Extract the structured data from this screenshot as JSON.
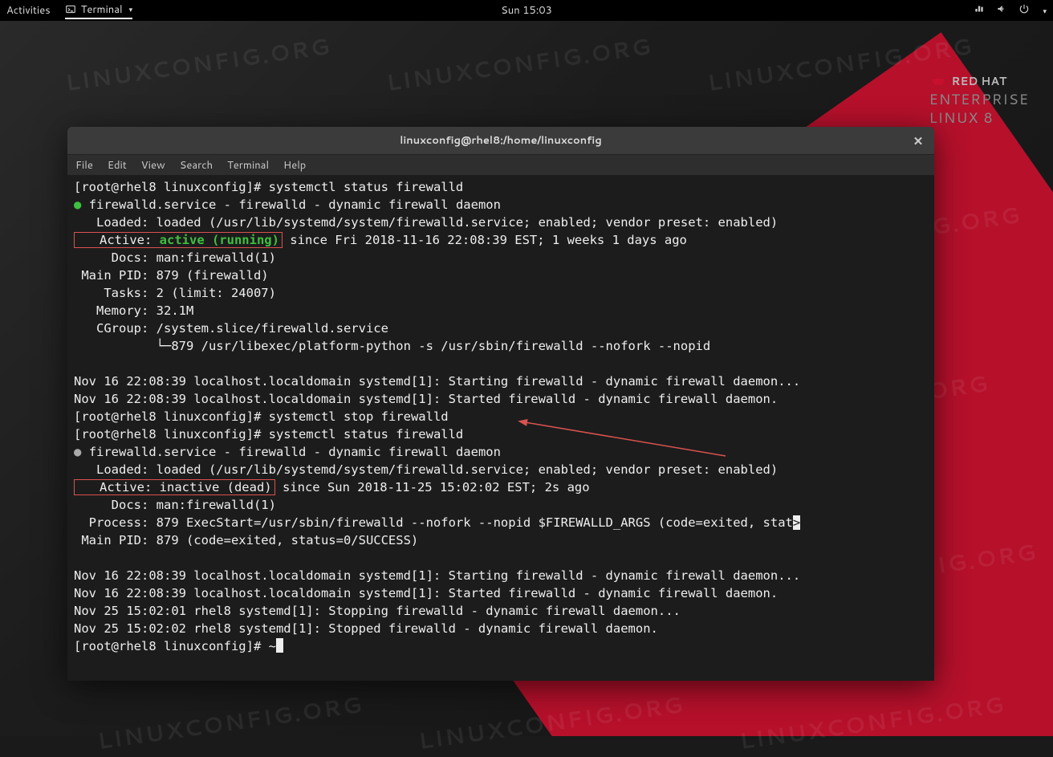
{
  "topbar": {
    "activities": "Activities",
    "terminal": "Terminal",
    "clock": "Sun 15:03"
  },
  "rh_logo": {
    "line1": "RED HAT",
    "line2": "ENTERPRISE",
    "line3": "LINUX 8"
  },
  "watermark_text": "LINUXCONFIG.ORG",
  "window": {
    "title": "linuxconfig@rhel8:/home/linuxconfig",
    "menus": [
      "File",
      "Edit",
      "View",
      "Search",
      "Terminal",
      "Help"
    ]
  },
  "term": {
    "prompt": "[root@rhel8 linuxconfig]# ",
    "cmd_status": "systemctl status firewalld",
    "cmd_stop": "systemctl stop firewalld",
    "cmd_final": "~",
    "status1": {
      "head": "firewalld.service - firewalld - dynamic firewall daemon",
      "loaded": "   Loaded: loaded (/usr/lib/systemd/system/firewalld.service; enabled; vendor preset: enabled)",
      "active_pre": "   Active: ",
      "active_state": "active (running)",
      "active_post": " since Fri 2018-11-16 22:08:39 EST; 1 weeks 1 days ago",
      "docs": "     Docs: man:firewalld(1)",
      "mainpid": " Main PID: 879 (firewalld)",
      "tasks": "    Tasks: 2 (limit: 24007)",
      "memory": "   Memory: 32.1M",
      "cgroup": "   CGroup: /system.slice/firewalld.service",
      "cgroup2": "           └─879 /usr/libexec/platform-python -s /usr/sbin/firewalld --nofork --nopid",
      "log1": "Nov 16 22:08:39 localhost.localdomain systemd[1]: Starting firewalld - dynamic firewall daemon...",
      "log2": "Nov 16 22:08:39 localhost.localdomain systemd[1]: Started firewalld - dynamic firewall daemon."
    },
    "status2": {
      "head": "firewalld.service - firewalld - dynamic firewall daemon",
      "loaded": "   Loaded: loaded (/usr/lib/systemd/system/firewalld.service; enabled; vendor preset: enabled)",
      "active_pre": "   Active: ",
      "active_state": "inactive (dead)",
      "active_post": " since Sun 2018-11-25 15:02:02 EST; 2s ago",
      "docs": "     Docs: man:firewalld(1)",
      "process": "  Process: 879 ExecStart=/usr/sbin/firewalld --nofork --nopid $FIREWALLD_ARGS (code=exited, stat",
      "process_tail": ">",
      "mainpid": " Main PID: 879 (code=exited, status=0/SUCCESS)",
      "log1": "Nov 16 22:08:39 localhost.localdomain systemd[1]: Starting firewalld - dynamic firewall daemon...",
      "log2": "Nov 16 22:08:39 localhost.localdomain systemd[1]: Started firewalld - dynamic firewall daemon.",
      "log3": "Nov 25 15:02:01 rhel8 systemd[1]: Stopping firewalld - dynamic firewall daemon...",
      "log4": "Nov 25 15:02:02 rhel8 systemd[1]: Stopped firewalld - dynamic firewall daemon."
    }
  }
}
